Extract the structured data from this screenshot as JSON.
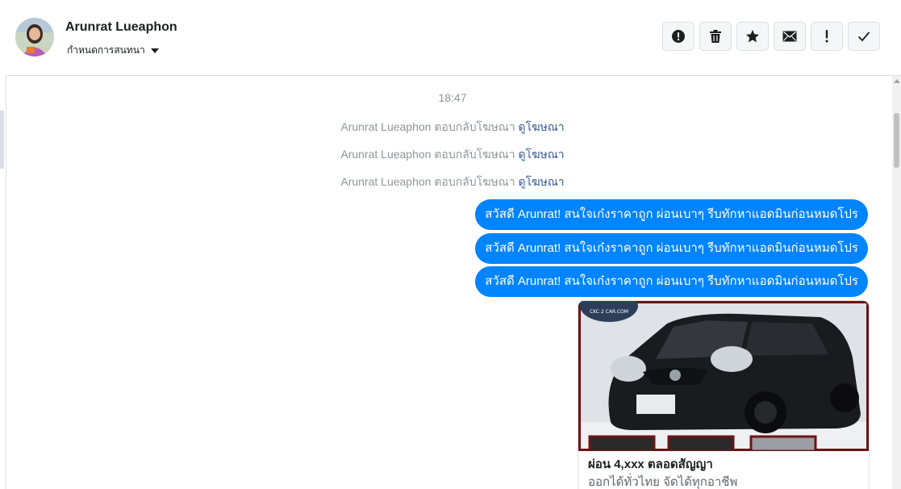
{
  "header": {
    "contact_name": "Arunrat Lueaphon",
    "assign_label": "กำหนดการสนทนา"
  },
  "toolbar": {
    "buttons": [
      {
        "name": "report-spam",
        "icon": "exclamation-circle-icon"
      },
      {
        "name": "delete",
        "icon": "trash-icon"
      },
      {
        "name": "star",
        "icon": "star-icon"
      },
      {
        "name": "mark-unread",
        "icon": "envelope-icon"
      },
      {
        "name": "follow-up",
        "icon": "exclamation-icon"
      },
      {
        "name": "mark-done",
        "icon": "check-icon"
      }
    ]
  },
  "thread": {
    "timestamp": "18:47",
    "system_messages": [
      {
        "text": "Arunrat Lueaphon ตอบกลับโฆษณา",
        "link": "ดูโฆษณา"
      },
      {
        "text": "Arunrat Lueaphon ตอบกลับโฆษณา",
        "link": "ดูโฆษณา"
      },
      {
        "text": "Arunrat Lueaphon ตอบกลับโฆษณา",
        "link": "ดูโฆษณา"
      }
    ],
    "outgoing": [
      "สวัสดี Arunrat! สนใจเก๋งราคาถูก ผ่อนเบาๆ รีบทักหาแอดมินก่อนหมดโปร",
      "สวัสดี Arunrat! สนใจเก๋งราคาถูก ผ่อนเบาๆ รีบทักหาแอดมินก่อนหมดโปร",
      "สวัสดี Arunrat! สนใจเก๋งราคาถูก ผ่อนเบาๆ รีบทักหาแอดมินก่อนหมดโปร"
    ],
    "ad_card": {
      "title": "ผ่อน 4,xxx ตลอดสัญญา",
      "subtitle": "ออกได้ทั่วไทย จัดได้ทุกอาชีพ",
      "watermark": "CKC 2 CAR.COM"
    }
  },
  "colors": {
    "bubble": "#0084ff",
    "link": "#385898",
    "system_text": "#90949c"
  }
}
